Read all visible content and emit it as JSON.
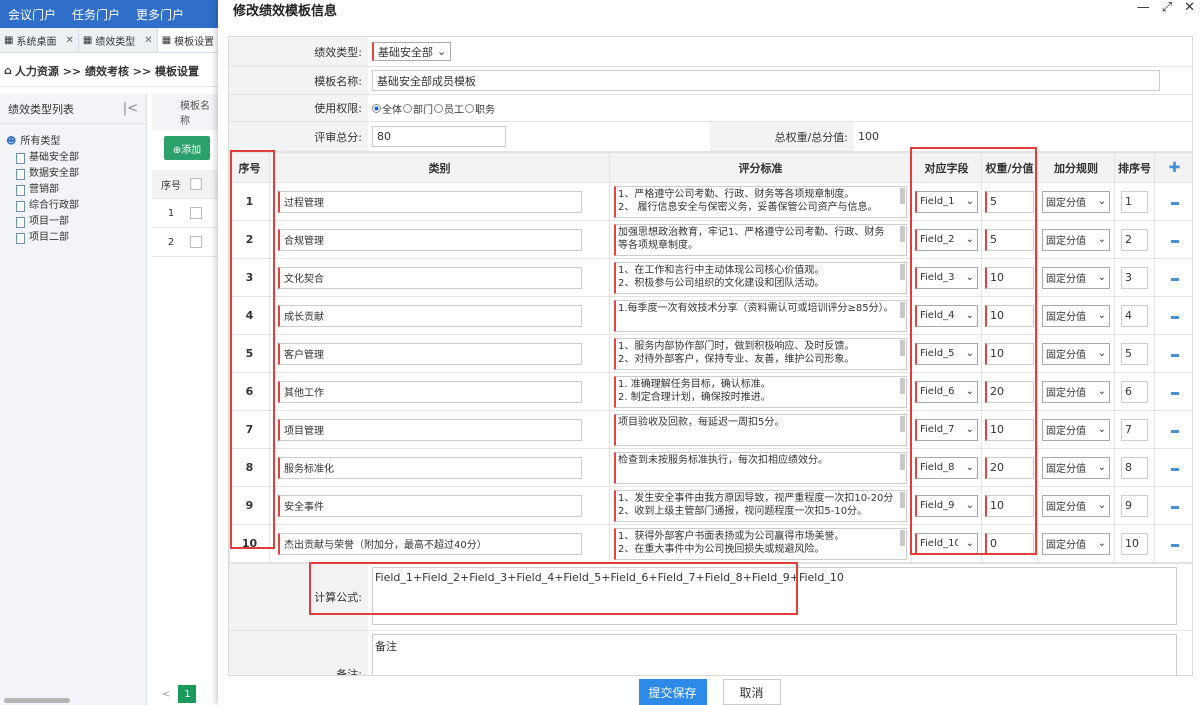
{
  "topnav": {
    "items": [
      "会议门户",
      "任务门户",
      "更多门户"
    ]
  },
  "tabs": [
    {
      "label": "系统桌面"
    },
    {
      "label": "绩效类型"
    },
    {
      "label": "模板设置"
    }
  ],
  "breadcrumb": "人力资源 >> 绩效考核 >> 模板设置",
  "leftpanel": {
    "title": "绩效类型列表",
    "root": "所有类型",
    "children": [
      "基础安全部",
      "数据安全部",
      "营销部",
      "综合行政部",
      "项目一部",
      "项目二部"
    ]
  },
  "mid": {
    "header": "模板名称",
    "add_label": "⊕添加",
    "col_no": "序号",
    "rows": [
      "1",
      "2"
    ],
    "page": "1"
  },
  "dialog": {
    "title": "修改绩效模板信息",
    "type_label": "绩效类型:",
    "type_value": "基础安全部",
    "name_label": "模板名称:",
    "name_value": "基础安全部成员模板",
    "perm_label": "使用权限:",
    "perm_options": [
      "全体",
      "部门",
      "员工",
      "职务"
    ],
    "total_label": "评审总分:",
    "total_value": "80",
    "weight_label": "总权重/总分值:",
    "weight_value": "100",
    "headers": {
      "no": "序号",
      "category": "类别",
      "criteria": "评分标准",
      "field": "对应字段",
      "weight": "权重/分值",
      "rule": "加分规则",
      "order": "排序号"
    },
    "rows": [
      {
        "no": "1",
        "category": "过程管理",
        "criteria": "1、严格遵守公司考勤、行政、财务等各项规章制度。\n2、 履行信息安全与保密义务，妥善保管公司资产与信息。",
        "field": "Field_1",
        "weight": "5",
        "rule": "固定分值",
        "order": "1"
      },
      {
        "no": "2",
        "category": "合规管理",
        "criteria": "加强思想政治教育，牢记1、严格遵守公司考勤、行政、财务等各项规章制度。",
        "field": "Field_2",
        "weight": "5",
        "rule": "固定分值",
        "order": "2"
      },
      {
        "no": "3",
        "category": "文化契合",
        "criteria": "1、在工作和言行中主动体现公司核心价值观。\n2、积极参与公司组织的文化建设和团队活动。",
        "field": "Field_3",
        "weight": "10",
        "rule": "固定分值",
        "order": "3"
      },
      {
        "no": "4",
        "category": "成长贡献",
        "criteria": "1.每季度一次有效技术分享（资料需认可或培训评分≥85分）。",
        "field": "Field_4",
        "weight": "10",
        "rule": "固定分值",
        "order": "4"
      },
      {
        "no": "5",
        "category": "客户管理",
        "criteria": "1、服务内部协作部门时，做到积极响应、及时反馈。\n2、对待外部客户，保持专业、友善，维护公司形象。",
        "field": "Field_5",
        "weight": "10",
        "rule": "固定分值",
        "order": "5"
      },
      {
        "no": "6",
        "category": "其他工作",
        "criteria": "1. 准确理解任务目标，确认标准。\n2. 制定合理计划，确保按时推进。",
        "field": "Field_6",
        "weight": "20",
        "rule": "固定分值",
        "order": "6"
      },
      {
        "no": "7",
        "category": "项目管理",
        "criteria": "项目验收及回款，每延迟一周扣5分。",
        "field": "Field_7",
        "weight": "10",
        "rule": "固定分值",
        "order": "7"
      },
      {
        "no": "8",
        "category": "服务标准化",
        "criteria": "检查到未按服务标准执行，每次扣相应绩效分。",
        "field": "Field_8",
        "weight": "20",
        "rule": "固定分值",
        "order": "8"
      },
      {
        "no": "9",
        "category": "安全事件",
        "criteria": "1、发生安全事件由我方原因导致，视严重程度一次扣10-20分\n2、收到上级主管部门通报，视问题程度一次扣5-10分。",
        "field": "Field_9",
        "weight": "10",
        "rule": "固定分值",
        "order": "9"
      },
      {
        "no": "10",
        "category": "杰出贡献与荣誉（附加分，最高不超过40分）",
        "criteria": "1、获得外部客户书面表扬或为公司赢得市场美誉。\n2、在重大事件中为公司挽回损失或规避风险。",
        "field": "Field_10",
        "weight": "0",
        "rule": "固定分值",
        "order": "10"
      }
    ],
    "formula_label": "计算公式:",
    "formula_value": "Field_1+Field_2+Field_3+Field_4+Field_5+Field_6+Field_7+Field_8+Field_9+Field_10",
    "remark_label": "备注:",
    "remark_value": "备注",
    "submit_label": "提交保存",
    "cancel_label": "取消"
  },
  "colors": {
    "accent": "#2c8ae8",
    "highlight": "#e23d3d",
    "nav": "#2f6fc9",
    "add": "#2aa16a"
  }
}
